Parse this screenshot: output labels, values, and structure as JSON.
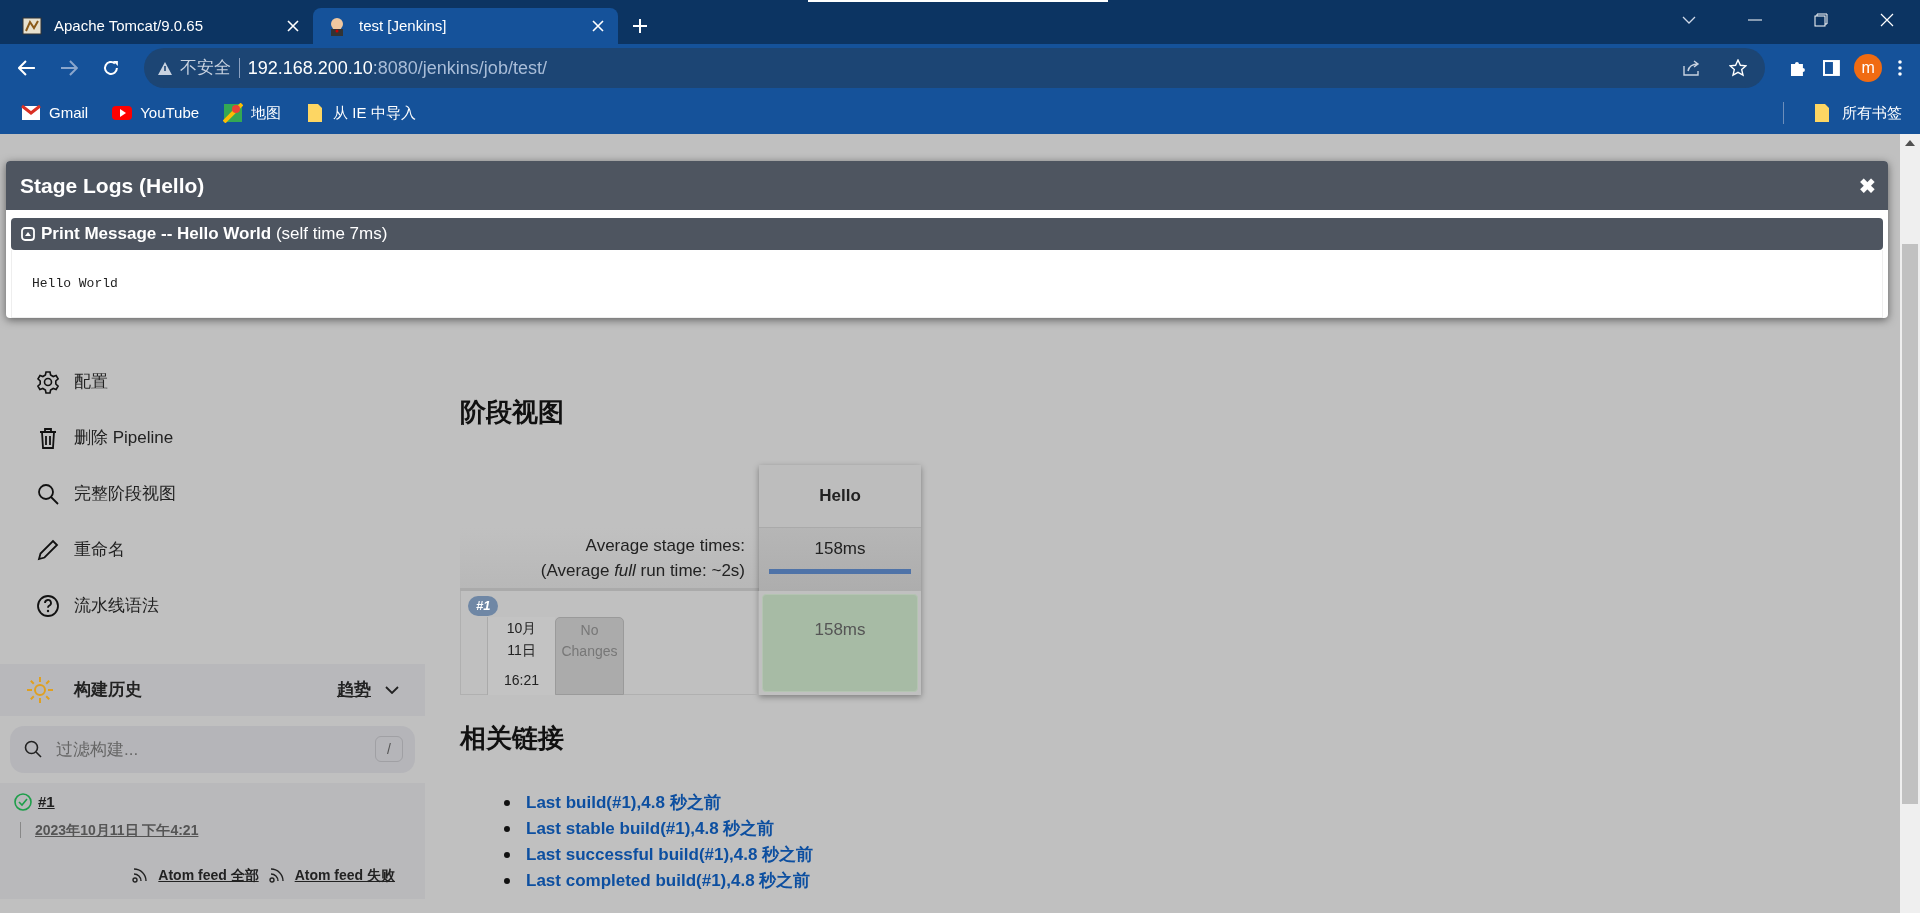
{
  "browser": {
    "tabs": [
      {
        "title": "Apache Tomcat/9.0.65",
        "selected": false
      },
      {
        "title": "test [Jenkins]",
        "selected": true
      }
    ],
    "address": {
      "security": "不安全",
      "host": "192.168.200.10",
      "rest": ":8080/jenkins/job/test/"
    },
    "profile_initial": "m",
    "bookmarks": [
      {
        "kind": "gmail",
        "label": "Gmail"
      },
      {
        "kind": "youtube",
        "label": "YouTube"
      },
      {
        "kind": "maps",
        "label": "地图"
      },
      {
        "kind": "folder",
        "label": "从 IE 中导入"
      }
    ],
    "all_bookmarks": "所有书签"
  },
  "sidebar": {
    "items": [
      {
        "kind": "gear",
        "label": "配置"
      },
      {
        "kind": "trash",
        "label": "删除 Pipeline"
      },
      {
        "kind": "search",
        "label": "完整阶段视图"
      },
      {
        "kind": "pencil",
        "label": "重命名"
      },
      {
        "kind": "help",
        "label": "流水线语法"
      }
    ],
    "build_history": {
      "title": "构建历史",
      "trend": "趋势",
      "filter_placeholder": "过滤构建...",
      "shortcut": "/",
      "builds": [
        {
          "number": "#1",
          "time": "2023年10月11日 下午4:21",
          "passed": true
        }
      ],
      "feeds": [
        "Atom feed 全部",
        "Atom feed 失败"
      ]
    }
  },
  "stage_view": {
    "title": "阶段视图",
    "avg_label": "Average stage times:",
    "avg_full": "(Average *full* run time: ~2s)",
    "stages": [
      {
        "name": "Hello",
        "avg": "158ms"
      }
    ],
    "builds": [
      {
        "badge": "#1",
        "date_line_1": "10月",
        "date_line_2": "11日",
        "time": "16:21",
        "changes": "No Changes",
        "cells": [
          {
            "duration": "158ms",
            "passed": true
          }
        ]
      }
    ]
  },
  "related_links": {
    "title": "相关链接",
    "links": [
      "Last build(#1),4.8 秒之前",
      "Last stable build(#1),4.8 秒之前",
      "Last successful build(#1),4.8 秒之前",
      "Last completed build(#1),4.8 秒之前"
    ]
  },
  "modal": {
    "title": "Stage Logs (Hello)",
    "close": "✖",
    "step": {
      "name": "Print Message -- Hello World",
      "self_time": "(self time 7ms)",
      "expanded": true,
      "log": "Hello World"
    }
  }
}
